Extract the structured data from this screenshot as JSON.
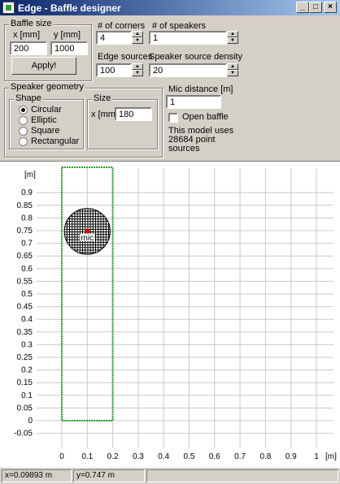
{
  "window": {
    "title": "Edge - Baffle designer",
    "buttons": {
      "minimize": "_",
      "maximize": "□",
      "close": "×"
    }
  },
  "baffle_size": {
    "group_label": "Baffle size",
    "x_label": "x [mm]",
    "y_label": "y [mm]",
    "x_value": "200",
    "y_value": "1000",
    "apply_label": "Apply!"
  },
  "corners": {
    "label": "# of corners",
    "value": "4"
  },
  "speakers": {
    "label": "# of speakers",
    "value": "1"
  },
  "edge_sources": {
    "label": "Edge sources",
    "value": "100"
  },
  "speaker_density": {
    "label": "Speaker source density",
    "value": "20"
  },
  "speaker_geometry": {
    "group_label": "Speaker geometry",
    "shape_label": "Shape",
    "shapes": [
      "Circular",
      "Elliptic",
      "Square",
      "Rectangular"
    ],
    "selected_shape": "Circular",
    "size_label": "Size",
    "size_x_label": "x [mm]",
    "size_x_value": "180"
  },
  "mic": {
    "distance_label": "Mic distance [m]",
    "distance_value": "1",
    "open_baffle_label": "Open baffle",
    "open_baffle_checked": false,
    "model_info": [
      "This model uses",
      "28684 point",
      "sources"
    ]
  },
  "plot": {
    "y_unit": "[m]",
    "x_unit": "[m]",
    "y_ticks": [
      "0.9",
      "0.85",
      "0.8",
      "0.75",
      "0.7",
      "0.65",
      "0.6",
      "0.55",
      "0.5",
      "0.45",
      "0.4",
      "0.35",
      "0.3",
      "0.25",
      "0.2",
      "0.15",
      "0.1",
      "0.05",
      "0",
      "-0.05"
    ],
    "x_ticks": [
      "0",
      "0.1",
      "0.2",
      "0.3",
      "0.4",
      "0.5",
      "0.6",
      "0.7",
      "0.8",
      "0.9",
      "1"
    ],
    "mic_label": "mic",
    "baffle_color": "#2a9a2a",
    "speaker_color": "#000000",
    "mic_color": "#cc0000"
  },
  "status": {
    "x": "x=0.09893 m",
    "y": "y=0.747 m"
  }
}
